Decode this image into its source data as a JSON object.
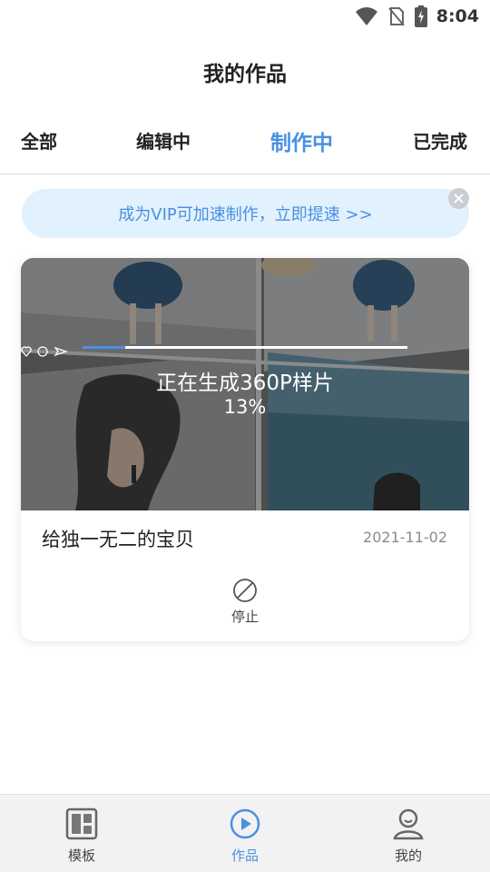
{
  "status_bar": {
    "time": "8:04"
  },
  "header": {
    "title": "我的作品"
  },
  "tabs": [
    {
      "label": "全部",
      "active": false
    },
    {
      "label": "编辑中",
      "active": false
    },
    {
      "label": "制作中",
      "active": true
    },
    {
      "label": "已完成",
      "active": false
    }
  ],
  "banner": {
    "text": "成为VIP可加速制作，立即提速 >>"
  },
  "work": {
    "title": "给独一无二的宝贝",
    "date": "2021-11-02",
    "status_text": "正在生成360P样片",
    "progress_text": "13%",
    "progress": 0.13,
    "stop_label": "停止"
  },
  "bottom_nav": [
    {
      "label": "模板",
      "icon": "template-icon",
      "active": false
    },
    {
      "label": "作品",
      "icon": "play-icon",
      "active": true
    },
    {
      "label": "我的",
      "icon": "profile-icon",
      "active": false
    }
  ],
  "colors": {
    "accent": "#4a90e2",
    "banner_bg": "#e1f1fd"
  }
}
